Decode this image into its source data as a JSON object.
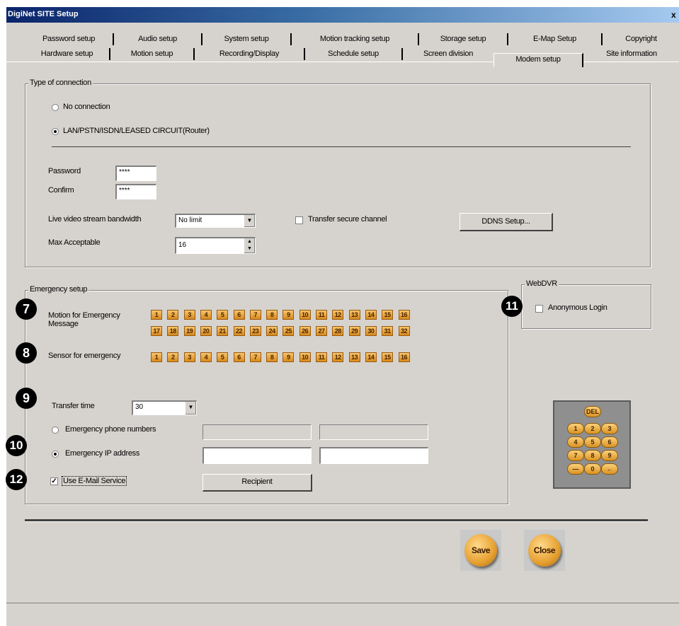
{
  "window": {
    "title": "DigiNet SITE Setup",
    "close_label": "x"
  },
  "tabs_row1": [
    "Password setup",
    "Audio setup",
    "System setup",
    "Motion tracking setup",
    "Storage setup",
    "E-Map Setup",
    "Copyright"
  ],
  "tabs_row2": [
    "Hardware setup",
    "Motion setup",
    "Recording/Display",
    "Schedule setup",
    "Screen division",
    "Modem setup",
    "Site information"
  ],
  "connection": {
    "group_label": "Type of connection",
    "opt_none": "No connection",
    "opt_lan": "LAN/PSTN/ISDN/LEASED CIRCUIT(Router)",
    "selected": "lan",
    "password_label": "Password",
    "password_value": "****",
    "confirm_label": "Confirm",
    "confirm_value": "****",
    "bandwidth_label": "Live video stream bandwidth",
    "bandwidth_value": "No limit",
    "secure_label": "Transfer secure channel",
    "ddns_label": "DDNS Setup...",
    "max_label": "Max Acceptable",
    "max_value": "16"
  },
  "emergency": {
    "group_label": "Emergency setup",
    "motion_label_1": "Motion for Emergency",
    "motion_label_2": "Message",
    "motion_row1": [
      "1",
      "2",
      "3",
      "4",
      "5",
      "6",
      "7",
      "8",
      "9",
      "10",
      "11",
      "12",
      "13",
      "14",
      "15",
      "16"
    ],
    "motion_row2": [
      "17",
      "18",
      "19",
      "20",
      "21",
      "22",
      "23",
      "24",
      "25",
      "26",
      "27",
      "28",
      "29",
      "30",
      "31",
      "32"
    ],
    "sensor_label": "Sensor for emergency",
    "sensor_row": [
      "1",
      "2",
      "3",
      "4",
      "5",
      "6",
      "7",
      "8",
      "9",
      "10",
      "11",
      "12",
      "13",
      "14",
      "15",
      "16"
    ],
    "transfer_label": "Transfer time",
    "transfer_value": "30",
    "phone_label": "Emergency phone numbers",
    "ip_label": "Emergency IP address",
    "email_label": "Use E-Mail Service",
    "recipient_label": "Recipient"
  },
  "webdvr": {
    "group_label": "WebDVR",
    "anon_label": "Anonymous Login"
  },
  "badges": [
    "7",
    "8",
    "9",
    "10",
    "11",
    "12"
  ],
  "keypad": {
    "del": "DEL",
    "keys": [
      "1",
      "2",
      "3",
      "4",
      "5",
      "6",
      "7",
      "8",
      "9",
      "—",
      "0",
      "←"
    ]
  },
  "actions": {
    "save": "Save",
    "close": "Close"
  },
  "check_mark": "✓"
}
